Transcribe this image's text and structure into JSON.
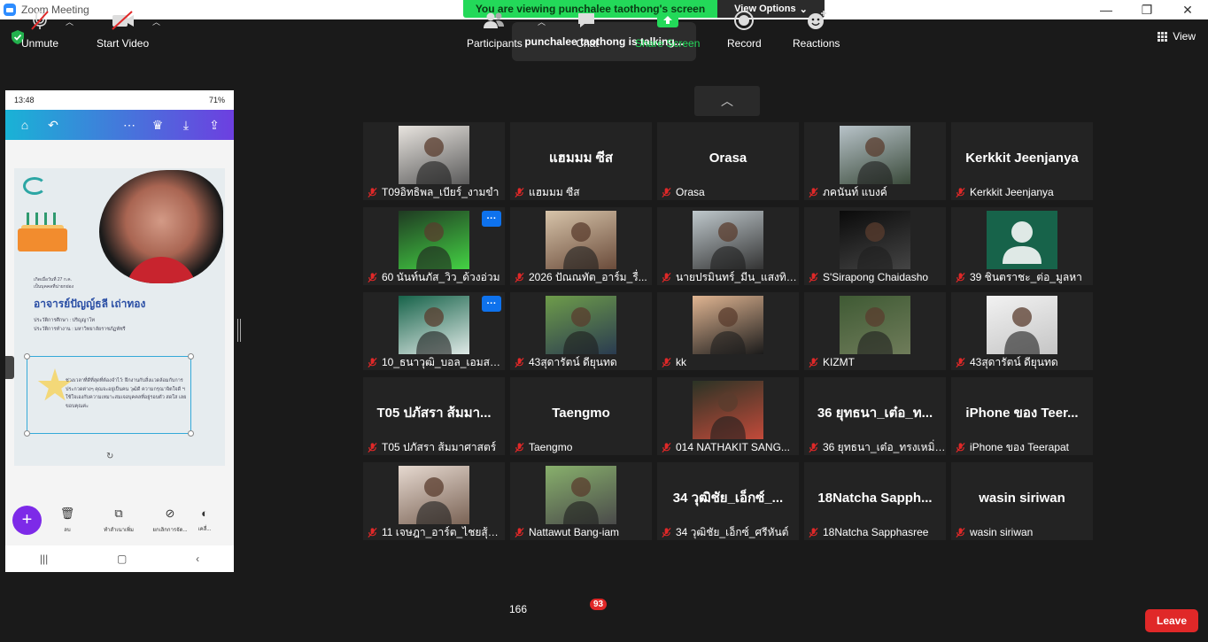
{
  "window": {
    "title": "Zoom Meeting",
    "minimize": "—",
    "restore": "❐",
    "close": "✕"
  },
  "banner": {
    "viewing": "You are viewing punchalee taothong's screen",
    "view_options": "View Options"
  },
  "talking": "punchalee taothong is talking...",
  "view_label": "View",
  "phone": {
    "time": "13:48",
    "battery": "71%",
    "card": {
      "name": "อาจารย์ปัญญ์ธลี เถ่าทอง",
      "small1": "เกิดเมื่อวันที่ 27 ก.ค.",
      "small2": "เป็นบุคคลที่น่ายกย่อง",
      "line1": "ประวัติการศึกษา : ปริญญาโท",
      "line2": "ประวัติการทำงาน : มหาวิทยาลัยราชภัฏพัชรี",
      "sel_text": "ช่วงเวลาที่ดีที่สุดที่ต้องจำไว้: ฝึกงานกับสิ่งแวดล้อมกับการประกวดต่างๆ คุณจะอยู่เป็นคน วุฒิดี ความกรุณาจิตใจดี ฯ ใช้ใจเองกับความเหมาะสมเจอบุคคลที่อยู่รอบตัว สดใส เลย ขอบคุณค่ะ"
    },
    "tools": [
      {
        "icon": "🗑",
        "label": "ลบ"
      },
      {
        "icon": "⧉",
        "label": "ทำสำเนาเพิ่ม"
      },
      {
        "icon": "⊘",
        "label": "ยกเลิกการจัด..."
      },
      {
        "icon": "◐",
        "label": "เคลื่..."
      }
    ],
    "nav": [
      "|||",
      "▢",
      "‹"
    ]
  },
  "participants": [
    {
      "name": "T09อิทธิพล_เบียร์_งามขำ",
      "video": true
    },
    {
      "name": "แฮมมม ซีส",
      "display": "แฮมมม ซีส",
      "video": false
    },
    {
      "name": "Orasa",
      "display": "Orasa",
      "video": false
    },
    {
      "name": "ภคนันท์ แบงค์",
      "video": true
    },
    {
      "name": "Kerkkit Jeenjanya",
      "display": "Kerkkit Jeenjanya",
      "video": false
    },
    {
      "name": "60 นันท์นภัส_วิว_ด้วงอ่วม",
      "video": true,
      "more": true
    },
    {
      "name": "2026 ปัณณทัต_อาร์ม_รื่...",
      "video": true
    },
    {
      "name": "นายปรมินทร์_มีน_แสงทิพ...",
      "video": true
    },
    {
      "name": "S'Sirapong Chaidasho",
      "video": true
    },
    {
      "name": "39 ชินตราชะ_ต่อ_มูลหา",
      "video": true,
      "avatar": true
    },
    {
      "name": "10_ธนาวุฒิ_บอล_เอมสอาด",
      "video": true,
      "more": true
    },
    {
      "name": "43สุดารัตน์ ดียุนทด",
      "video": true
    },
    {
      "name": "kk",
      "video": true
    },
    {
      "name": "KIZMT",
      "video": true
    },
    {
      "name": "43สุดารัตน์ ดียุนทด",
      "video": true
    },
    {
      "name": "T05 ปภัสรา ส้มมาศาสตร์",
      "display": "T05 ปภัสรา ส้มมา...",
      "video": false
    },
    {
      "name": "Taengmo",
      "display": "Taengmo",
      "video": false
    },
    {
      "name": "014 NATHAKIT SANG...",
      "video": true
    },
    {
      "name": "36 ยุทธนา_เต๋อ_ทรงเหมิ่ง...",
      "display": "36 ยุทธนา_เต๋อ_ท...",
      "video": false
    },
    {
      "name": "iPhone ของ Teerapat",
      "display": "iPhone ของ Teer...",
      "video": false
    },
    {
      "name": "11 เจษฎา_อาร์ต_ไชยสุ้ม_เ...",
      "video": true
    },
    {
      "name": "Nattawut Bang-iam",
      "video": true
    },
    {
      "name": "34 วุฒิชัย_เอ็กซ์_ศรีหันต์",
      "display": "34 วุฒิชัย_เอ็กซ์_...",
      "video": false
    },
    {
      "name": "18Natcha Sapphasree",
      "display": "18Natcha  Sapph...",
      "video": false
    },
    {
      "name": "wasin siriwan",
      "display": "wasin siriwan",
      "video": false
    }
  ],
  "toolbar": {
    "unmute": "Unmute",
    "start_video": "Start Video",
    "participants": "Participants",
    "participant_count": "166",
    "chat": "Chat",
    "chat_badge": "93",
    "share_screen": "Share Screen",
    "record": "Record",
    "reactions": "Reactions",
    "leave": "Leave"
  },
  "colors": {
    "share_green": "#23d959",
    "leave_red": "#e02828",
    "accent_blue": "#0e72ed"
  }
}
